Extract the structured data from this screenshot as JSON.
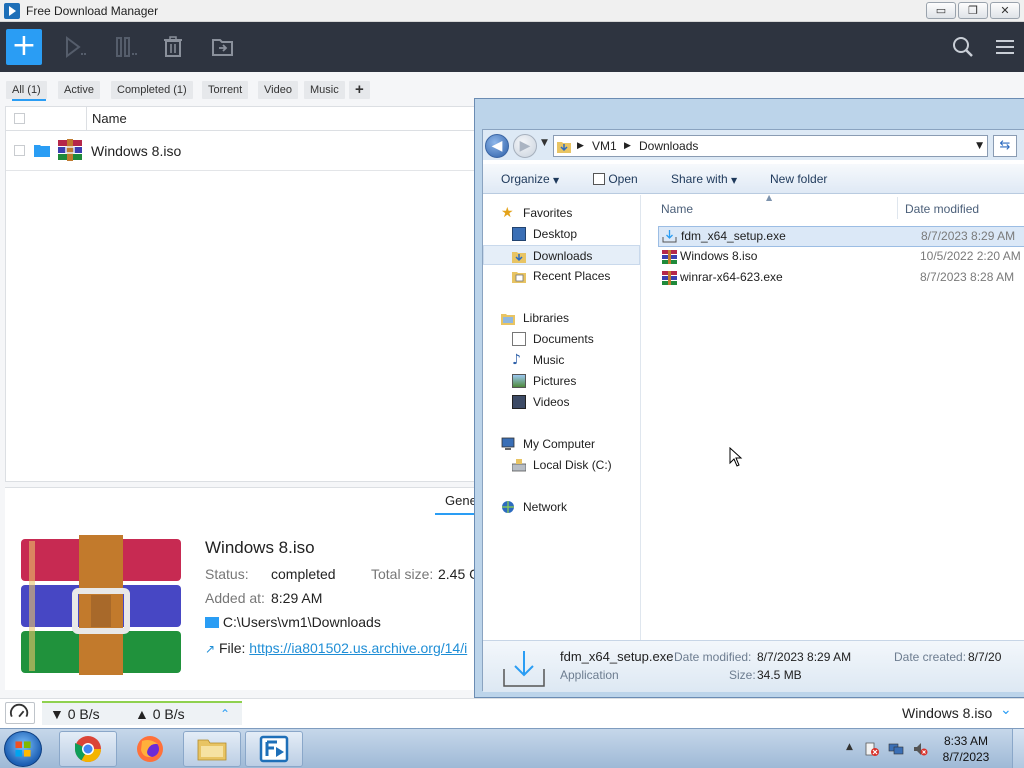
{
  "fdm": {
    "window_title": "Free Download Manager",
    "window_buttons": {
      "minimize": "▭",
      "restore": "❐",
      "close": "✕"
    },
    "toolbar": {
      "add_label": "+"
    },
    "filters": [
      "All (1)",
      "Active",
      "Completed (1)",
      "Torrent",
      "Video",
      "Music",
      "+"
    ],
    "list": {
      "column_name": "Name",
      "rows": [
        {
          "name": "Windows 8.iso"
        }
      ]
    },
    "details": {
      "tab": "Gene",
      "title": "Windows 8.iso",
      "status_label": "Status:",
      "status_value": "completed",
      "total_size_label": "Total size:",
      "total_size_value": "2.45 G",
      "added_label": "Added at:",
      "added_value": "8:29 AM",
      "folder": "C:\\Users\\vm1\\Downloads",
      "file_label": "File:",
      "file_link": "https://ia801502.us.archive.org/14/i"
    },
    "status_bar": {
      "down_speed": "▼ 0 B/s",
      "up_speed": "▲ 0 B/s",
      "current_file": "Windows 8.iso"
    },
    "colors": {
      "accent": "#2a9df4",
      "toolbar_bg": "#2e3440"
    }
  },
  "explorer": {
    "breadcrumb": [
      "VM1",
      "Downloads"
    ],
    "commands": {
      "organize": "Organize",
      "open": "Open",
      "share_with": "Share with",
      "new_folder": "New folder"
    },
    "nav": {
      "favorites": "Favorites",
      "desktop": "Desktop",
      "downloads": "Downloads",
      "recent_places": "Recent Places",
      "libraries": "Libraries",
      "documents": "Documents",
      "music": "Music",
      "pictures": "Pictures",
      "videos": "Videos",
      "my_computer": "My Computer",
      "local_disk": "Local Disk (C:)",
      "network": "Network"
    },
    "columns": {
      "name": "Name",
      "date_modified": "Date modified"
    },
    "files": [
      {
        "name": "fdm_x64_setup.exe",
        "date": "8/7/2023 8:29 AM",
        "icon": "installer-icon",
        "selected": true
      },
      {
        "name": "Windows 8.iso",
        "date": "10/5/2022 2:20 AM",
        "icon": "winrar-icon",
        "selected": false
      },
      {
        "name": "winrar-x64-623.exe",
        "date": "8/7/2023 8:28 AM",
        "icon": "winrar-icon",
        "selected": false
      }
    ],
    "status": {
      "file_name": "fdm_x64_setup.exe",
      "file_type": "Application",
      "date_modified_label": "Date modified:",
      "date_modified_value": "8/7/2023 8:29 AM",
      "size_label": "Size:",
      "size_value": "34.5 MB",
      "date_created_label": "Date created:",
      "date_created_value": "8/7/20"
    }
  },
  "taskbar": {
    "time": "8:33 AM",
    "date": "8/7/2023",
    "apps": [
      "start-orb",
      "chrome-icon",
      "firefox-icon",
      "explorer-icon",
      "fdm-icon"
    ]
  }
}
